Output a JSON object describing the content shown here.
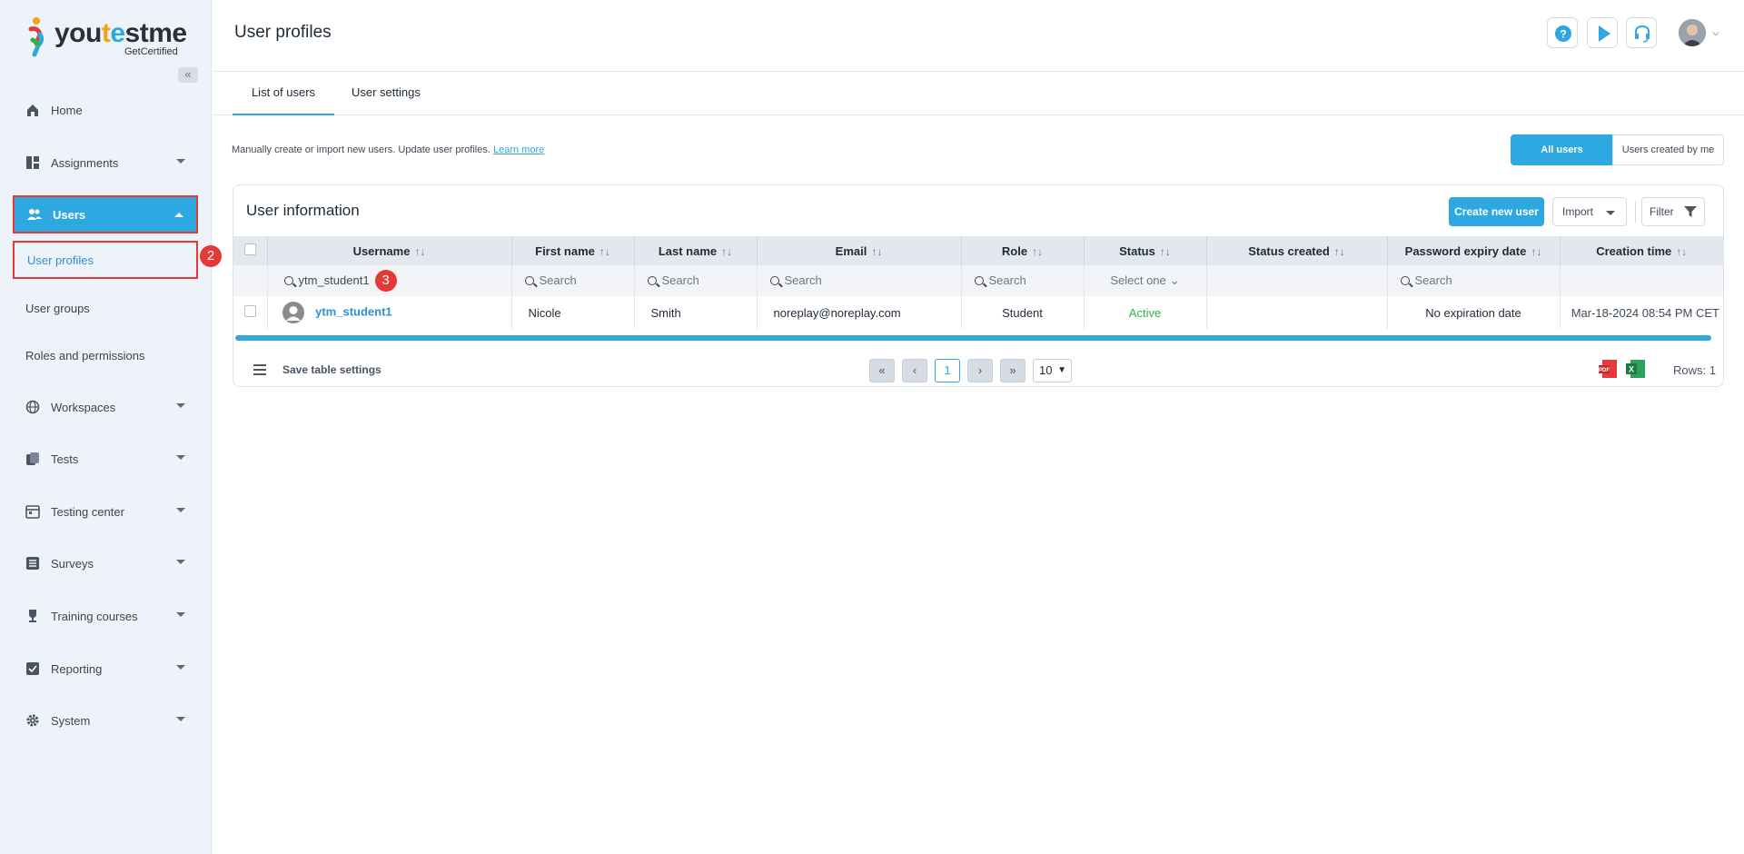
{
  "brand": {
    "name_you": "you",
    "name_t": "t",
    "name_e": "e",
    "name_st": "st",
    "name_me": "me",
    "tagline": "GetCertified"
  },
  "sidebar": {
    "items": [
      {
        "label": "Home",
        "icon": "home-icon"
      },
      {
        "label": "Assignments",
        "icon": "dashboard-icon"
      },
      {
        "label": "Users",
        "icon": "users-icon"
      },
      {
        "label": "Workspaces",
        "icon": "globe-icon"
      },
      {
        "label": "Tests",
        "icon": "tests-icon"
      },
      {
        "label": "Testing center",
        "icon": "calendar-icon"
      },
      {
        "label": "Surveys",
        "icon": "list-icon"
      },
      {
        "label": "Training courses",
        "icon": "trophy-icon"
      },
      {
        "label": "Reporting",
        "icon": "report-icon"
      },
      {
        "label": "System",
        "icon": "gear-icon"
      }
    ],
    "users_sub": [
      "User profiles",
      "User groups",
      "Roles and permissions"
    ],
    "badges": [
      "2",
      "3"
    ]
  },
  "header": {
    "title": "User profiles"
  },
  "tabs": [
    "List of users",
    "User settings"
  ],
  "intro": {
    "text": "Manually create or import new users. Update user profiles.",
    "link": "Learn more"
  },
  "toggle": {
    "all": "All users",
    "mine": "Users created by me"
  },
  "card": {
    "title": "User information",
    "create": "Create new user",
    "import": "Import",
    "filter": "Filter"
  },
  "table": {
    "columns": [
      "Username",
      "First name",
      "Last name",
      "Email",
      "Role",
      "Status",
      "Status created",
      "Password expiry date",
      "Creation time"
    ],
    "filters": {
      "username": "ytm_student1",
      "search": "Search",
      "status": "Select one"
    },
    "rows": [
      {
        "username": "ytm_student1",
        "first": "Nicole",
        "last": "Smith",
        "email": "noreplay@noreplay.com",
        "role": "Student",
        "status": "Active",
        "status_created": "",
        "password_expiry": "No expiration date",
        "creation_time": "Mar-18-2024 08:54 PM CET"
      }
    ]
  },
  "footer": {
    "save": "Save table settings",
    "page": "1",
    "page_size": "10",
    "rows": "Rows: 1"
  },
  "colors": {
    "accent": "#2ea8e0",
    "highlight": "#e53935",
    "active": "#2fb344"
  }
}
